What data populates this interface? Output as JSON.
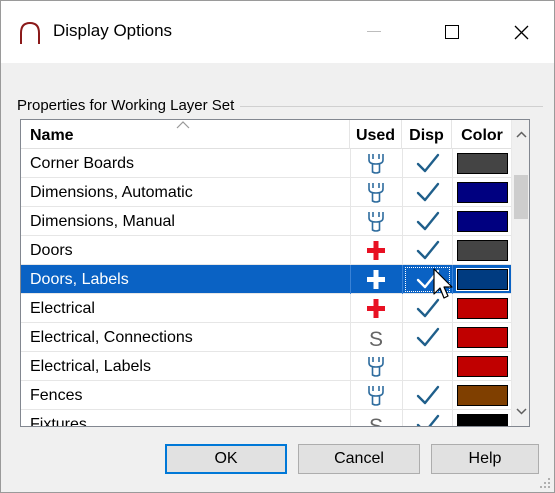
{
  "window": {
    "title": "Display Options",
    "icon": "app-arch-icon",
    "controls": [
      "minimize-icon",
      "maximize-icon",
      "close-icon"
    ]
  },
  "group": {
    "label": "Properties for  Working Layer Set"
  },
  "table": {
    "columns": {
      "name": "Name",
      "used": "Used",
      "disp": "Disp",
      "color": "Color"
    },
    "rows": [
      {
        "name": "Corner Boards",
        "used": "in-use",
        "disp": true,
        "color": "#444444",
        "selected": false
      },
      {
        "name": "Dimensions,  Automatic",
        "used": "in-use",
        "disp": true,
        "color": "#000080",
        "selected": false
      },
      {
        "name": "Dimensions,  Manual",
        "used": "in-use",
        "disp": true,
        "color": "#000080",
        "selected": false
      },
      {
        "name": "Doors",
        "used": "add",
        "disp": true,
        "color": "#444444",
        "selected": false
      },
      {
        "name": "Doors, Labels",
        "used": "add",
        "disp": true,
        "color": "#003b80",
        "selected": true
      },
      {
        "name": "Electrical",
        "used": "add",
        "disp": true,
        "color": "#c00000",
        "selected": false
      },
      {
        "name": "Electrical, Connections",
        "used": "system",
        "disp": true,
        "color": "#c00000",
        "selected": false
      },
      {
        "name": "Electrical, Labels",
        "used": "in-use",
        "disp": false,
        "color": "#c00000",
        "selected": false
      },
      {
        "name": "Fences",
        "used": "in-use",
        "disp": true,
        "color": "#7f3f00",
        "selected": false
      },
      {
        "name": "Fixtures",
        "used": "system",
        "disp": true,
        "color": "#000000",
        "selected": false
      }
    ]
  },
  "buttons": {
    "ok": "OK",
    "cancel": "Cancel",
    "help": "Help"
  },
  "colors": {
    "selection": "#0a62c4",
    "check": "#1f5f8b",
    "add": "#e81123",
    "in_use": "#2e6c9e",
    "system": "#666666"
  }
}
